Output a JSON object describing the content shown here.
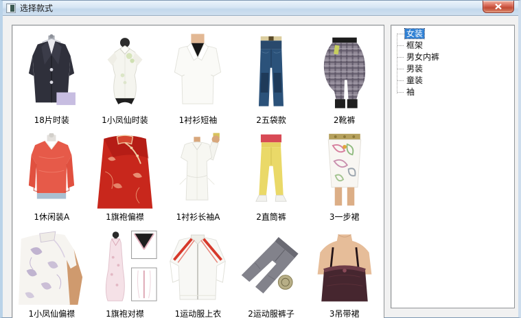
{
  "window": {
    "title": "选择款式"
  },
  "grid": {
    "items": [
      {
        "label": "18片时装",
        "icon": "blazer-icon"
      },
      {
        "label": "1小凤仙时装",
        "icon": "xiaofengxian-blouse-icon"
      },
      {
        "label": "1衬衫短袖",
        "icon": "short-sleeve-shirt-icon"
      },
      {
        "label": "2五袋款",
        "icon": "five-pocket-jeans-icon"
      },
      {
        "label": "2靴裤",
        "icon": "plaid-boot-pants-icon"
      },
      {
        "label": "1休闲装A",
        "icon": "casual-top-icon"
      },
      {
        "label": "1旗袍偏襟",
        "icon": "red-qipao-icon"
      },
      {
        "label": "1衬衫长袖A",
        "icon": "long-sleeve-shirt-icon"
      },
      {
        "label": "2直筒裤",
        "icon": "straight-pants-icon"
      },
      {
        "label": "3一步裙",
        "icon": "pencil-skirt-icon"
      },
      {
        "label": "1小凤仙偏襟",
        "icon": "white-qipao-icon"
      },
      {
        "label": "1旗袍对襟",
        "icon": "qipao-dress-icon"
      },
      {
        "label": "1运动服上衣",
        "icon": "track-jacket-icon"
      },
      {
        "label": "2运动服裤子",
        "icon": "track-pants-icon"
      },
      {
        "label": "3吊带裙",
        "icon": "camisole-icon"
      }
    ]
  },
  "tree": {
    "items": [
      {
        "label": "女装",
        "selected": true
      },
      {
        "label": "框架",
        "selected": false
      },
      {
        "label": "男女内裤",
        "selected": false
      },
      {
        "label": "男装",
        "selected": false
      },
      {
        "label": "童装",
        "selected": false
      },
      {
        "label": "袖",
        "selected": false
      }
    ]
  },
  "colors": {
    "selection_bg": "#2f80d4",
    "titlebar": "#cfe0f0",
    "close_button": "#c24a35",
    "panel_border": "#8f9396"
  }
}
